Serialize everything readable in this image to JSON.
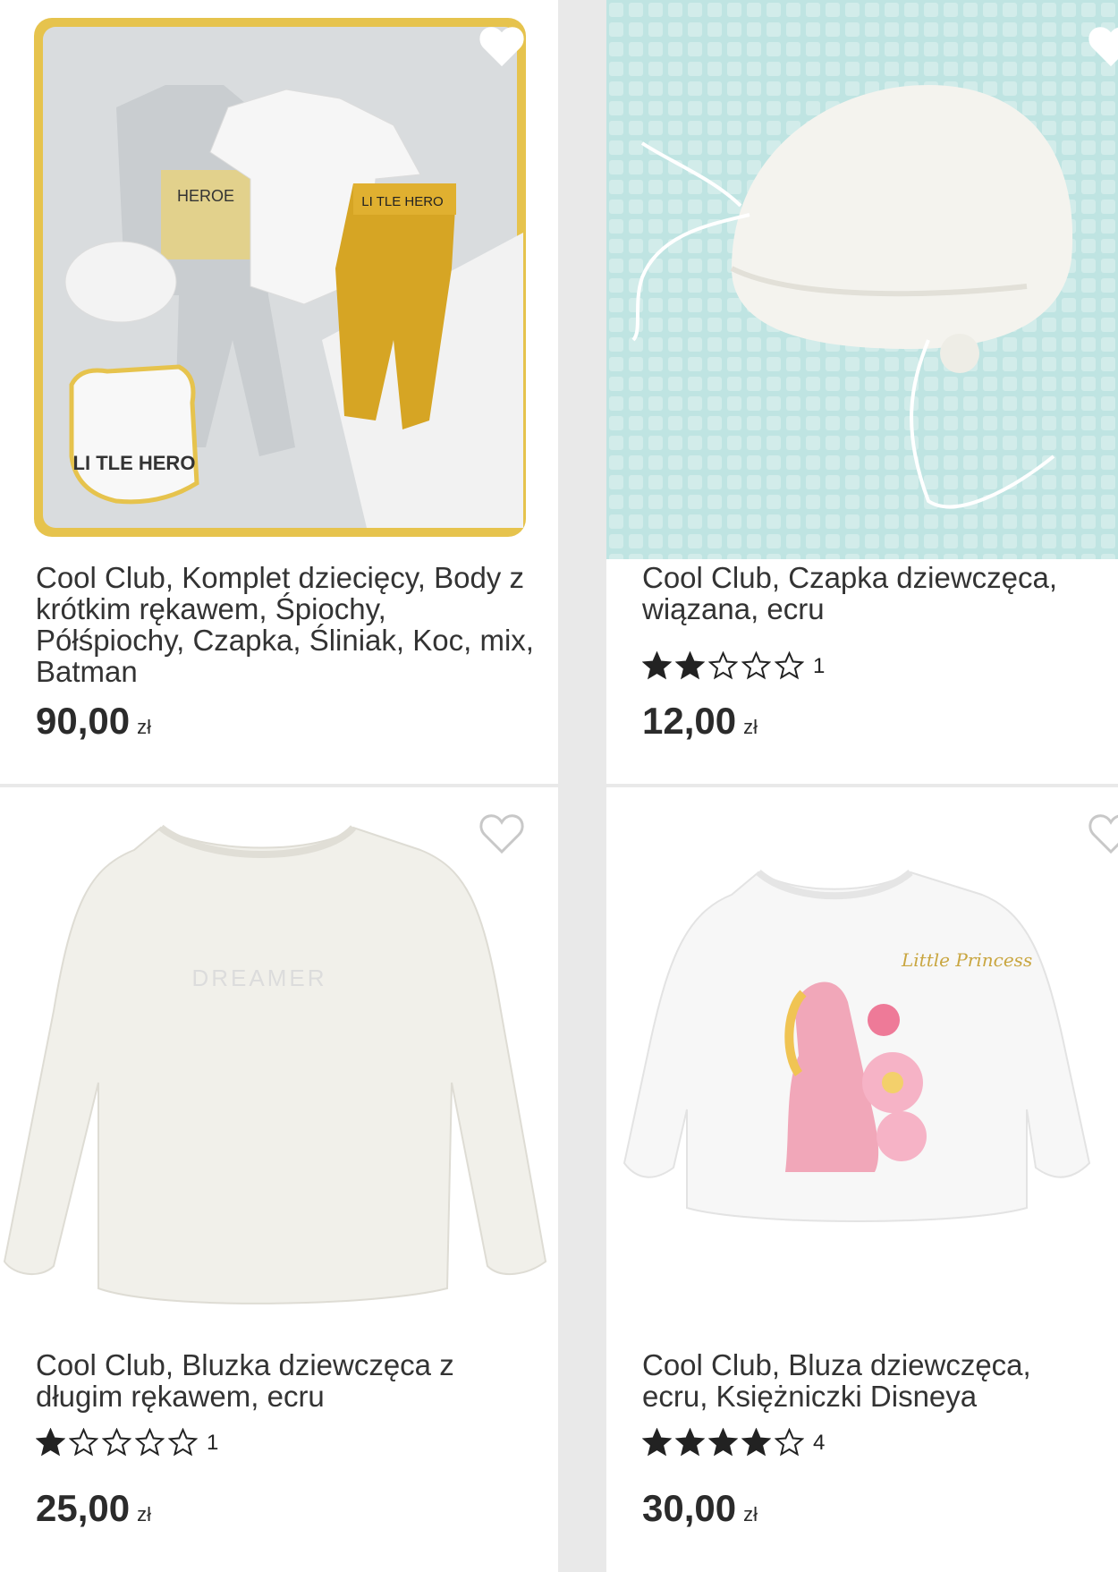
{
  "products": [
    {
      "title": "Cool Club, Komplet dziecięcy, Body z krótkim rękawem, Śpiochy, Półśpiochy, Czapka, Śliniak, Koc, mix, Batman",
      "price": "90,00",
      "currency": "zł",
      "rating": null,
      "reviews": null
    },
    {
      "title": "Cool Club, Czapka dziewczęca, wiązana, ecru",
      "price": "12,00",
      "currency": "zł",
      "rating": 2,
      "reviews": "1"
    },
    {
      "title": "Cool Club, Bluzka dziewczęca z długim rękawem, ecru",
      "price": "25,00",
      "currency": "zł",
      "rating": 1,
      "reviews": "1"
    },
    {
      "title": "Cool Club, Bluza dziewczęca, ecru, Księżniczki Disneya",
      "price": "30,00",
      "currency": "zł",
      "rating": 4,
      "reviews": "4"
    }
  ],
  "image_text": {
    "batman_bib": "LI TLE HERO",
    "batman_overall": "HEROE",
    "batman_pants": "LI TLE HERO",
    "shirt_print": "DREAMER",
    "sweatshirt_print": "Little Princess"
  },
  "icons": {
    "favorite": "heart-outline-icon",
    "star_full": "star-filled-icon",
    "star_empty": "star-outline-icon"
  },
  "colors": {
    "background": "#e9e9e9",
    "card": "#ffffff",
    "text": "#333333",
    "star": "#222222"
  }
}
